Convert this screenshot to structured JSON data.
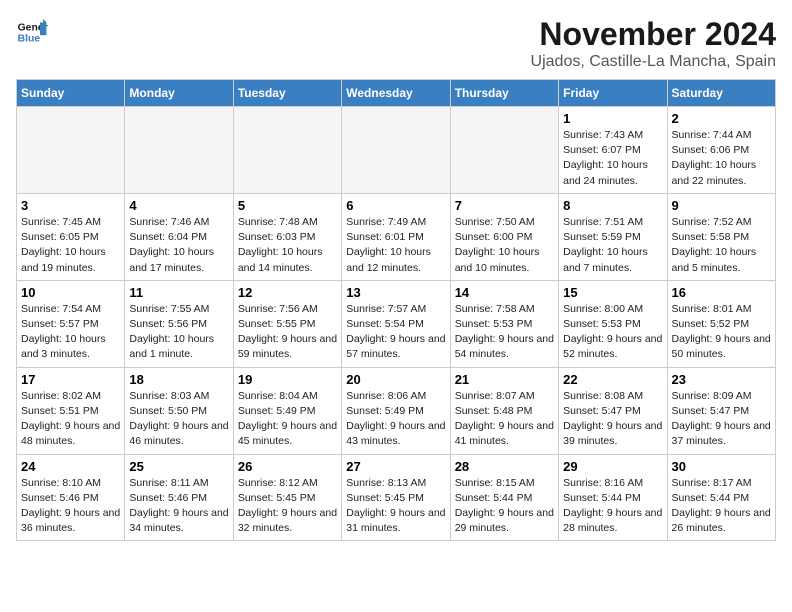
{
  "logo": {
    "line1": "General",
    "line2": "Blue"
  },
  "title": "November 2024",
  "location": "Ujados, Castille-La Mancha, Spain",
  "weekdays": [
    "Sunday",
    "Monday",
    "Tuesday",
    "Wednesday",
    "Thursday",
    "Friday",
    "Saturday"
  ],
  "weeks": [
    [
      {
        "day": "",
        "info": ""
      },
      {
        "day": "",
        "info": ""
      },
      {
        "day": "",
        "info": ""
      },
      {
        "day": "",
        "info": ""
      },
      {
        "day": "",
        "info": ""
      },
      {
        "day": "1",
        "info": "Sunrise: 7:43 AM\nSunset: 6:07 PM\nDaylight: 10 hours and 24 minutes."
      },
      {
        "day": "2",
        "info": "Sunrise: 7:44 AM\nSunset: 6:06 PM\nDaylight: 10 hours and 22 minutes."
      }
    ],
    [
      {
        "day": "3",
        "info": "Sunrise: 7:45 AM\nSunset: 6:05 PM\nDaylight: 10 hours and 19 minutes."
      },
      {
        "day": "4",
        "info": "Sunrise: 7:46 AM\nSunset: 6:04 PM\nDaylight: 10 hours and 17 minutes."
      },
      {
        "day": "5",
        "info": "Sunrise: 7:48 AM\nSunset: 6:03 PM\nDaylight: 10 hours and 14 minutes."
      },
      {
        "day": "6",
        "info": "Sunrise: 7:49 AM\nSunset: 6:01 PM\nDaylight: 10 hours and 12 minutes."
      },
      {
        "day": "7",
        "info": "Sunrise: 7:50 AM\nSunset: 6:00 PM\nDaylight: 10 hours and 10 minutes."
      },
      {
        "day": "8",
        "info": "Sunrise: 7:51 AM\nSunset: 5:59 PM\nDaylight: 10 hours and 7 minutes."
      },
      {
        "day": "9",
        "info": "Sunrise: 7:52 AM\nSunset: 5:58 PM\nDaylight: 10 hours and 5 minutes."
      }
    ],
    [
      {
        "day": "10",
        "info": "Sunrise: 7:54 AM\nSunset: 5:57 PM\nDaylight: 10 hours and 3 minutes."
      },
      {
        "day": "11",
        "info": "Sunrise: 7:55 AM\nSunset: 5:56 PM\nDaylight: 10 hours and 1 minute."
      },
      {
        "day": "12",
        "info": "Sunrise: 7:56 AM\nSunset: 5:55 PM\nDaylight: 9 hours and 59 minutes."
      },
      {
        "day": "13",
        "info": "Sunrise: 7:57 AM\nSunset: 5:54 PM\nDaylight: 9 hours and 57 minutes."
      },
      {
        "day": "14",
        "info": "Sunrise: 7:58 AM\nSunset: 5:53 PM\nDaylight: 9 hours and 54 minutes."
      },
      {
        "day": "15",
        "info": "Sunrise: 8:00 AM\nSunset: 5:53 PM\nDaylight: 9 hours and 52 minutes."
      },
      {
        "day": "16",
        "info": "Sunrise: 8:01 AM\nSunset: 5:52 PM\nDaylight: 9 hours and 50 minutes."
      }
    ],
    [
      {
        "day": "17",
        "info": "Sunrise: 8:02 AM\nSunset: 5:51 PM\nDaylight: 9 hours and 48 minutes."
      },
      {
        "day": "18",
        "info": "Sunrise: 8:03 AM\nSunset: 5:50 PM\nDaylight: 9 hours and 46 minutes."
      },
      {
        "day": "19",
        "info": "Sunrise: 8:04 AM\nSunset: 5:49 PM\nDaylight: 9 hours and 45 minutes."
      },
      {
        "day": "20",
        "info": "Sunrise: 8:06 AM\nSunset: 5:49 PM\nDaylight: 9 hours and 43 minutes."
      },
      {
        "day": "21",
        "info": "Sunrise: 8:07 AM\nSunset: 5:48 PM\nDaylight: 9 hours and 41 minutes."
      },
      {
        "day": "22",
        "info": "Sunrise: 8:08 AM\nSunset: 5:47 PM\nDaylight: 9 hours and 39 minutes."
      },
      {
        "day": "23",
        "info": "Sunrise: 8:09 AM\nSunset: 5:47 PM\nDaylight: 9 hours and 37 minutes."
      }
    ],
    [
      {
        "day": "24",
        "info": "Sunrise: 8:10 AM\nSunset: 5:46 PM\nDaylight: 9 hours and 36 minutes."
      },
      {
        "day": "25",
        "info": "Sunrise: 8:11 AM\nSunset: 5:46 PM\nDaylight: 9 hours and 34 minutes."
      },
      {
        "day": "26",
        "info": "Sunrise: 8:12 AM\nSunset: 5:45 PM\nDaylight: 9 hours and 32 minutes."
      },
      {
        "day": "27",
        "info": "Sunrise: 8:13 AM\nSunset: 5:45 PM\nDaylight: 9 hours and 31 minutes."
      },
      {
        "day": "28",
        "info": "Sunrise: 8:15 AM\nSunset: 5:44 PM\nDaylight: 9 hours and 29 minutes."
      },
      {
        "day": "29",
        "info": "Sunrise: 8:16 AM\nSunset: 5:44 PM\nDaylight: 9 hours and 28 minutes."
      },
      {
        "day": "30",
        "info": "Sunrise: 8:17 AM\nSunset: 5:44 PM\nDaylight: 9 hours and 26 minutes."
      }
    ]
  ]
}
